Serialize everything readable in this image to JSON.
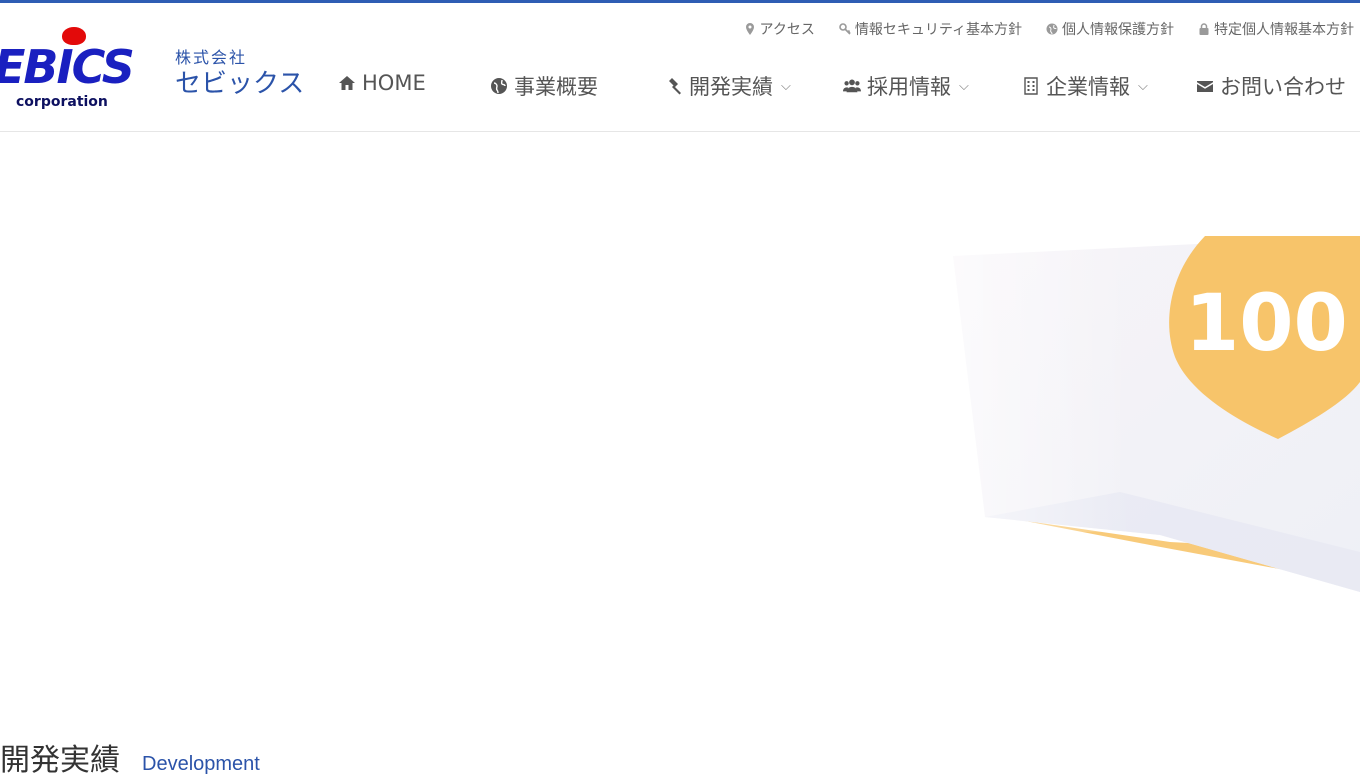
{
  "brand": {
    "logo_word": "EBICS",
    "logo_sub": "corporation",
    "company_kk": "株式会社",
    "company_name": "セビックス"
  },
  "utility_nav": [
    {
      "label": "アクセス",
      "icon": "map-pin-icon"
    },
    {
      "label": "情報セキュリティ基本方針",
      "icon": "key-icon"
    },
    {
      "label": "個人情報保護方針",
      "icon": "globe-icon"
    },
    {
      "label": "特定個人情報基本方針",
      "icon": "lock-icon"
    }
  ],
  "main_nav": [
    {
      "label": "HOME",
      "icon": "home-icon",
      "dropdown": false
    },
    {
      "label": "事業概要",
      "icon": "globe-icon",
      "dropdown": false
    },
    {
      "label": "開発実績",
      "icon": "gavel-icon",
      "dropdown": true
    },
    {
      "label": "採用情報",
      "icon": "users-icon",
      "dropdown": true
    },
    {
      "label": "企業情報",
      "icon": "building-icon",
      "dropdown": true
    },
    {
      "label": "お問い合わせ",
      "icon": "envelope-icon",
      "dropdown": false
    }
  ],
  "hero": {
    "badge_text": "100"
  },
  "section": {
    "title_jp": "開発実績",
    "title_en": "Development"
  },
  "colors": {
    "accent": "#2f5db4",
    "logo_blue": "#1a20c0",
    "logo_red": "#e30a0a",
    "badge_orange": "#f7c46a"
  }
}
